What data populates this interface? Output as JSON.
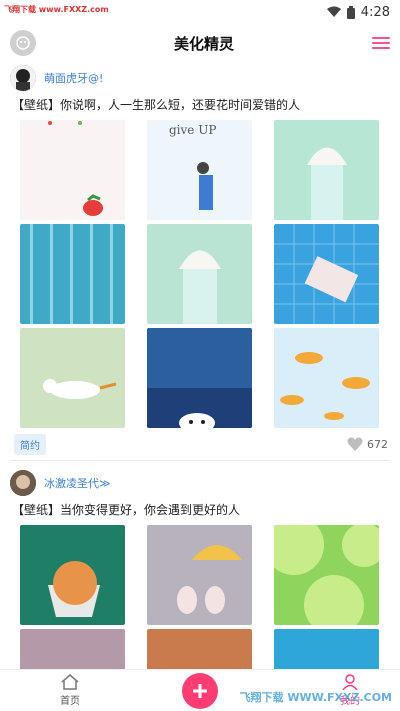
{
  "status": {
    "time": "4:28",
    "watermark": "飞翔下载 www.FXXZ.com"
  },
  "header": {
    "title": "美化精灵"
  },
  "posts": [
    {
      "username": "萌面虎牙@!",
      "text": "【壁纸】你说啊，人一生那么短，还要花时间爱错的人",
      "tag": "简约",
      "likes": "672",
      "tile_colors": [
        "#faf3f3",
        "#eef5fb",
        "#b8e6d4",
        "#3fa9c6",
        "#b9e3d3",
        "#3aa3df",
        "#cfe3c2",
        "#2c5f9e",
        "#d9eef8"
      ]
    },
    {
      "username": "冰激凌圣代≫",
      "text": "【壁纸】当你变得更好，你会遇到更好的人",
      "tile_colors": [
        "#1e7f66",
        "#b7b2bb",
        "#8fd45c",
        "#b49aa8",
        "#c97b4d",
        "#2fa6d8"
      ]
    }
  ],
  "nav": {
    "home": "首页",
    "right": "我的"
  },
  "brand_watermark": "飞翔下载 WWW.FXXZ.COM",
  "colors": {
    "accent": "#ff3d73",
    "link": "#3b7fd6"
  }
}
